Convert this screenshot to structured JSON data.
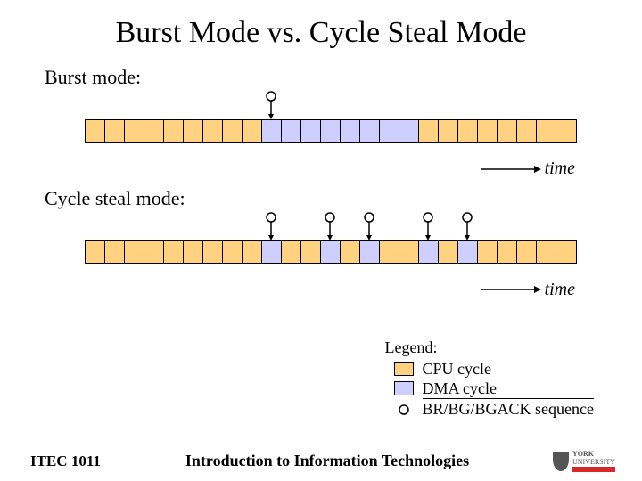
{
  "title": "Burst Mode vs. Cycle Steal Mode",
  "burst": {
    "label": "Burst mode:",
    "cells": [
      "cpu",
      "cpu",
      "cpu",
      "cpu",
      "cpu",
      "cpu",
      "cpu",
      "cpu",
      "cpu",
      "dma",
      "dma",
      "dma",
      "dma",
      "dma",
      "dma",
      "dma",
      "dma",
      "cpu",
      "cpu",
      "cpu",
      "cpu",
      "cpu",
      "cpu",
      "cpu",
      "cpu"
    ],
    "steal_points": [
      9
    ]
  },
  "cyclesteal": {
    "label": "Cycle steal mode:",
    "cells": [
      "cpu",
      "cpu",
      "cpu",
      "cpu",
      "cpu",
      "cpu",
      "cpu",
      "cpu",
      "cpu",
      "dma",
      "cpu",
      "cpu",
      "dma",
      "cpu",
      "dma",
      "cpu",
      "cpu",
      "dma",
      "cpu",
      "dma",
      "cpu",
      "cpu",
      "cpu",
      "cpu",
      "cpu"
    ],
    "steal_points": [
      9,
      12,
      14,
      17,
      19
    ]
  },
  "time_label": "time",
  "legend": {
    "title": "Legend:",
    "cpu": "CPU cycle",
    "dma": "DMA cycle",
    "br": "BR/BG/BGACK sequence"
  },
  "footer": {
    "course": "ITEC 1011",
    "subtitle": "Introduction to Information Technologies",
    "university": "YORK",
    "university_sub": "UNIVERSITY"
  }
}
